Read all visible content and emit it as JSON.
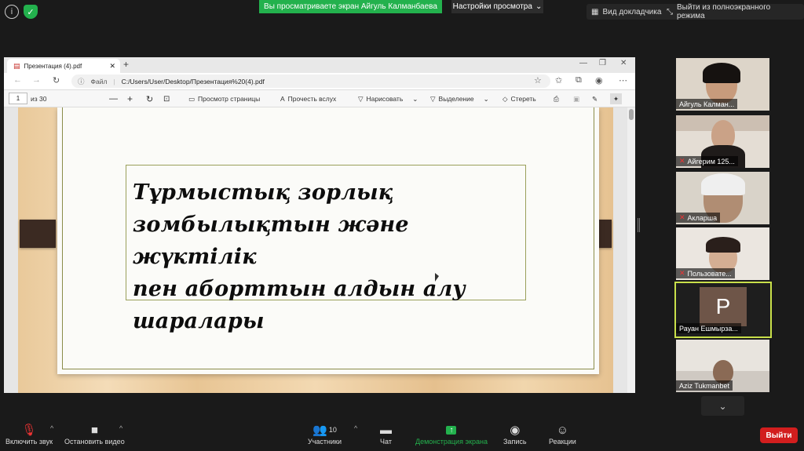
{
  "top": {
    "share_banner": "Вы просматриваете экран Айгуль Калманбаева",
    "view_settings": "Настройки просмотра",
    "view_docs": "Вид докладчика",
    "exit_fullscreen": "Выйти из полноэкранного режима"
  },
  "browser": {
    "tab_title": "Презентация (4).pdf",
    "url_label": "Файл",
    "url": "C:/Users/User/Desktop/Презентация%20(4).pdf",
    "page_current": "1",
    "page_total": "из 30",
    "toolbar": {
      "page_view": "Просмотр страницы",
      "read_aloud": "Прочесть вслух",
      "draw": "Нарисовать",
      "highlight": "Выделение",
      "erase": "Стереть"
    }
  },
  "slide": {
    "title_lines": [
      "Тұрмыстық зорлық",
      "зомбылықтын және жүктілік",
      "пен аборттын алдын алу",
      "шаралары"
    ]
  },
  "participants": [
    {
      "name": "Айгуль Калман...",
      "muted": false
    },
    {
      "name": "Айгерим 125...",
      "muted": true
    },
    {
      "name": "Акларша",
      "muted": true
    },
    {
      "name": "Пользовате...",
      "muted": true
    },
    {
      "name": "Рауан Ешмырза...",
      "initial": "P",
      "muted": false
    },
    {
      "name": "Aziz Tukmanbet",
      "muted": false
    }
  ],
  "controls": {
    "mute": "Включить звук",
    "video": "Остановить видео",
    "participants": "Участники",
    "participants_count": "10",
    "chat": "Чат",
    "share": "Демонстрация экрана",
    "record": "Запись",
    "reactions": "Реакции",
    "leave": "Выйти"
  },
  "colors": {
    "share_green": "#23b14d",
    "active_border": "#c9e04a",
    "leave_red": "#d21e1e"
  }
}
